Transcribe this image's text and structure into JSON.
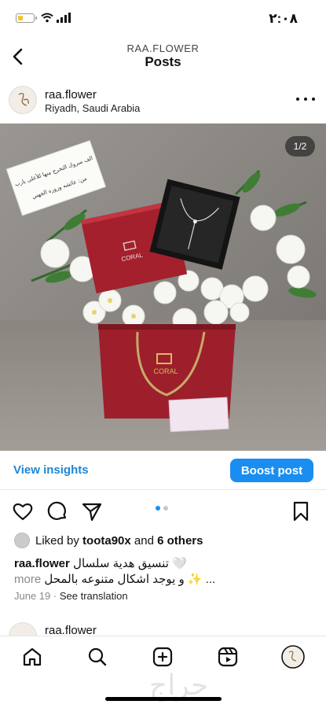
{
  "status_bar": {
    "time": "٢:٠٨",
    "battery_level": 0.35,
    "battery_color": "#f4c430"
  },
  "header": {
    "account": "RAA.FLOWER",
    "title": "Posts",
    "back_icon": "chevron-left-icon"
  },
  "post": {
    "username": "raa.flower",
    "location": "Riyadh, Saudi Arabia",
    "image_counter": "1/2",
    "image": {
      "card_line1": "الف مبروك التخرج منها للأعلى يارب",
      "card_line2": "من: عائشه وزوره الجهني",
      "box_brand": "CORAL"
    },
    "carousel": {
      "current": 1,
      "total": 2
    },
    "view_insights": "View insights",
    "boost_label": "Boost post",
    "likes": {
      "prefix": "Liked by",
      "user": "toota90x",
      "and": "and",
      "others": "6 others"
    },
    "caption": {
      "username": "raa.flower",
      "line1": "تنسيق هدية سلسال 🤍",
      "line2": "و يوجد اشكال متنوعه بالمحل ✨ ...",
      "more": "more"
    },
    "date": "June 19",
    "separator": "·",
    "see_translation": "See translation"
  },
  "next_post": {
    "username": "raa.flower"
  },
  "bottom_nav": {
    "tabs": [
      "home-icon",
      "search-icon",
      "create-icon",
      "reels-icon",
      "profile-icon"
    ],
    "watermark": "حراج"
  },
  "colors": {
    "accent": "#1a8ef0",
    "link": "#1d87d6",
    "box": "#9d1f2b"
  }
}
